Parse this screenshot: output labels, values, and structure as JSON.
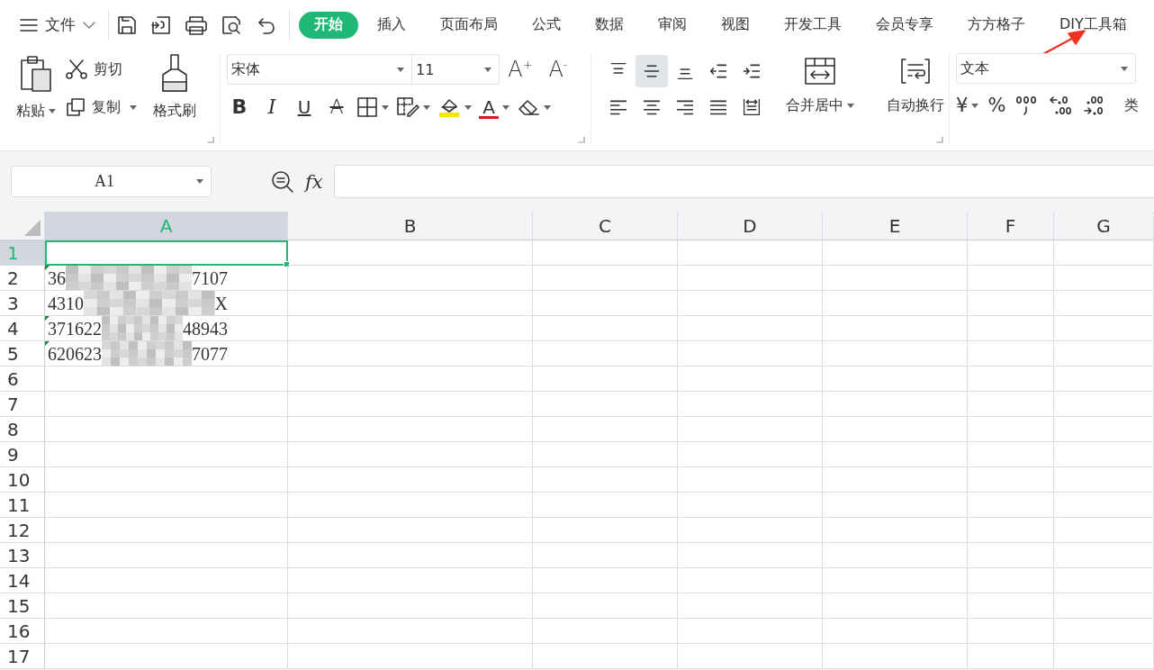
{
  "menu": {
    "label": "文件"
  },
  "tabs": [
    {
      "label": "开始",
      "selected": true
    },
    {
      "label": "插入",
      "selected": false
    },
    {
      "label": "页面布局",
      "selected": false
    },
    {
      "label": "公式",
      "selected": false
    },
    {
      "label": "数据",
      "selected": false
    },
    {
      "label": "审阅",
      "selected": false
    },
    {
      "label": "视图",
      "selected": false
    },
    {
      "label": "开发工具",
      "selected": false
    },
    {
      "label": "会员专享",
      "selected": false
    },
    {
      "label": "方方格子",
      "selected": false
    },
    {
      "label": "DIY工具箱",
      "selected": false
    }
  ],
  "clipboard": {
    "paste": "粘贴",
    "cut": "剪切",
    "copy": "复制",
    "format_painter": "格式刷"
  },
  "font": {
    "name": "宋体",
    "size": "11",
    "grow": "A$^{+}$",
    "shrink": "A$^{-}$",
    "styles": [
      {
        "kind": "bold",
        "label": "B"
      },
      {
        "kind": "italic",
        "label": "I"
      },
      {
        "kind": "underline",
        "label": "U"
      },
      {
        "kind": "strike",
        "label": "A"
      }
    ],
    "font_color": "A"
  },
  "alignment": {
    "buttons": [
      {
        "kind": "top",
        "selected": false
      },
      {
        "kind": "middle",
        "selected": true
      },
      {
        "kind": "bottom",
        "selected": false
      },
      {
        "kind": "outdent",
        "selected": false
      },
      {
        "kind": "indent",
        "selected": false
      },
      {
        "kind": "left",
        "selected": false
      },
      {
        "kind": "center",
        "selected": false
      },
      {
        "kind": "right",
        "selected": false
      },
      {
        "kind": "justify",
        "selected": false
      },
      {
        "kind": "distribute",
        "selected": false
      }
    ],
    "merge": "合并居中",
    "wrap": "自动换行"
  },
  "number": {
    "format": "文本",
    "currency": "¥",
    "percent": "%",
    "cut_label": "类"
  },
  "name_box": "A1",
  "formula_bar": {
    "function_label": "fx"
  },
  "grid": {
    "columns": [
      {
        "label": "A",
        "selected": true
      },
      {
        "label": "B",
        "selected": false
      },
      {
        "label": "C",
        "selected": false
      },
      {
        "label": "D",
        "selected": false
      },
      {
        "label": "E",
        "selected": false
      },
      {
        "label": "F",
        "selected": false
      },
      {
        "label": "G",
        "selected": false
      }
    ],
    "rows": [
      {
        "label": "1",
        "selected": true
      },
      {
        "label": "2",
        "selected": false,
        "cell_a": {
          "start": "36",
          "end": "7107",
          "flag": true
        }
      },
      {
        "label": "3",
        "selected": false,
        "cell_a": {
          "start": "4310",
          "end": "X",
          "flag": false
        }
      },
      {
        "label": "4",
        "selected": false,
        "cell_a": {
          "start": "371622",
          "end": "48943",
          "flag": true
        }
      },
      {
        "label": "5",
        "selected": false,
        "cell_a": {
          "start": "620623",
          "end": "7077",
          "flag": true
        }
      },
      {
        "label": "6",
        "selected": false
      },
      {
        "label": "7",
        "selected": false
      },
      {
        "label": "8",
        "selected": false
      },
      {
        "label": "9",
        "selected": false
      },
      {
        "label": "10",
        "selected": false
      },
      {
        "label": "11",
        "selected": false
      },
      {
        "label": "12",
        "selected": false
      },
      {
        "label": "13",
        "selected": false
      },
      {
        "label": "14",
        "selected": false
      },
      {
        "label": "15",
        "selected": false
      },
      {
        "label": "16",
        "selected": false
      },
      {
        "label": "17",
        "selected": false
      }
    ]
  }
}
